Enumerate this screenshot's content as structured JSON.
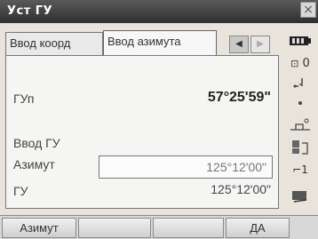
{
  "window": {
    "title": "Уст ГУ",
    "close": "×"
  },
  "tabs": [
    {
      "label": "Ввод коорд"
    },
    {
      "label": "Ввод азимута"
    }
  ],
  "tab_nav": {
    "prev": "◀",
    "next": "▶"
  },
  "fields": {
    "gup_label": "ГУп",
    "gup_value": "57°25'59\"",
    "section_label": "Ввод ГУ",
    "azimuth_label": "Азимут",
    "azimuth_value": "125°12'00\"",
    "gu_label": "ГУ",
    "gu_value": "125°12'00\""
  },
  "status": [
    {
      "icon": "battery-icon"
    },
    {
      "icon": "prism-constant-icon",
      "text": "0"
    },
    {
      "icon": "signal-icon"
    },
    {
      "icon": "dot-icon"
    },
    {
      "icon": "tilt-icon"
    },
    {
      "icon": "target-icon"
    },
    {
      "icon": "page-icon",
      "text": "1"
    },
    {
      "icon": "input-mode-icon"
    }
  ],
  "softkeys": [
    "Азимут",
    "",
    "",
    "ДА"
  ]
}
